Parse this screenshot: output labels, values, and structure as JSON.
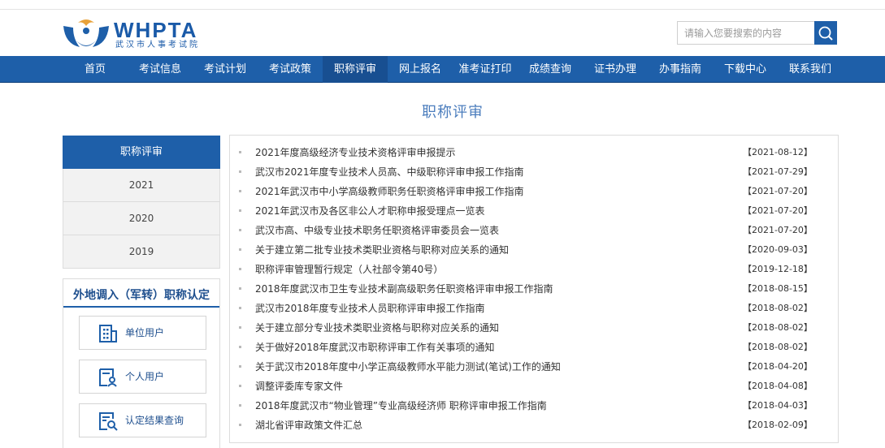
{
  "brand": {
    "name": "WHPTA",
    "subtitle": "武汉市人事考试院",
    "color": "#1e5fa9"
  },
  "search": {
    "placeholder": "请输入您要搜索的内容"
  },
  "nav": {
    "items": [
      {
        "label": "首页"
      },
      {
        "label": "考试信息"
      },
      {
        "label": "考试计划"
      },
      {
        "label": "考试政策"
      },
      {
        "label": "职称评审"
      },
      {
        "label": "网上报名"
      },
      {
        "label": "准考证打印"
      },
      {
        "label": "成绩查询"
      },
      {
        "label": "证书办理"
      },
      {
        "label": "办事指南"
      },
      {
        "label": "下载中心"
      },
      {
        "label": "联系我们"
      }
    ],
    "active_index": 4
  },
  "page_title": "职称评审",
  "sidebar": {
    "heading": "职称评审",
    "years": [
      "2021",
      "2020",
      "2019"
    ]
  },
  "transfer": {
    "title": "外地调入（军转）职称认定",
    "buttons": [
      {
        "label": "单位用户",
        "icon": "building-icon"
      },
      {
        "label": "个人用户",
        "icon": "person-card-icon"
      },
      {
        "label": "认定结果查询",
        "icon": "document-search-icon"
      }
    ]
  },
  "articles": [
    {
      "title": "2021年度高级经济专业技术资格评审申报提示",
      "date": "【2021-08-12】"
    },
    {
      "title": "武汉市2021年度专业技术人员高、中级职称评审申报工作指南",
      "date": "【2021-07-29】"
    },
    {
      "title": "2021年武汉市中小学高级教师职务任职资格评审申报工作指南",
      "date": "【2021-07-20】"
    },
    {
      "title": "2021年武汉市及各区非公人才职称申报受理点一览表",
      "date": "【2021-07-20】"
    },
    {
      "title": "武汉市高、中级专业技术职务任职资格评审委员会一览表",
      "date": "【2021-07-20】"
    },
    {
      "title": "关于建立第二批专业技术类职业资格与职称对应关系的通知",
      "date": "【2020-09-03】"
    },
    {
      "title": "职称评审管理暂行规定（人社部令第40号）",
      "date": "【2019-12-18】"
    },
    {
      "title": "2018年度武汉市卫生专业技术副高级职务任职资格评审申报工作指南",
      "date": "【2018-08-15】"
    },
    {
      "title": "武汉市2018年度专业技术人员职称评审申报工作指南",
      "date": "【2018-08-02】"
    },
    {
      "title": "关于建立部分专业技术类职业资格与职称对应关系的通知",
      "date": "【2018-08-02】"
    },
    {
      "title": "关于做好2018年度武汉市职称评审工作有关事项的通知",
      "date": "【2018-08-02】"
    },
    {
      "title": "关于武汉市2018年度中小学正高级教师水平能力测试(笔试)工作的通知",
      "date": "【2018-04-20】"
    },
    {
      "title": "调整评委库专家文件",
      "date": "【2018-04-08】"
    },
    {
      "title": "2018年度武汉市“物业管理”专业高级经济师 职称评审申报工作指南",
      "date": "【2018-04-03】"
    },
    {
      "title": "湖北省评审政策文件汇总",
      "date": "【2018-02-09】"
    }
  ]
}
